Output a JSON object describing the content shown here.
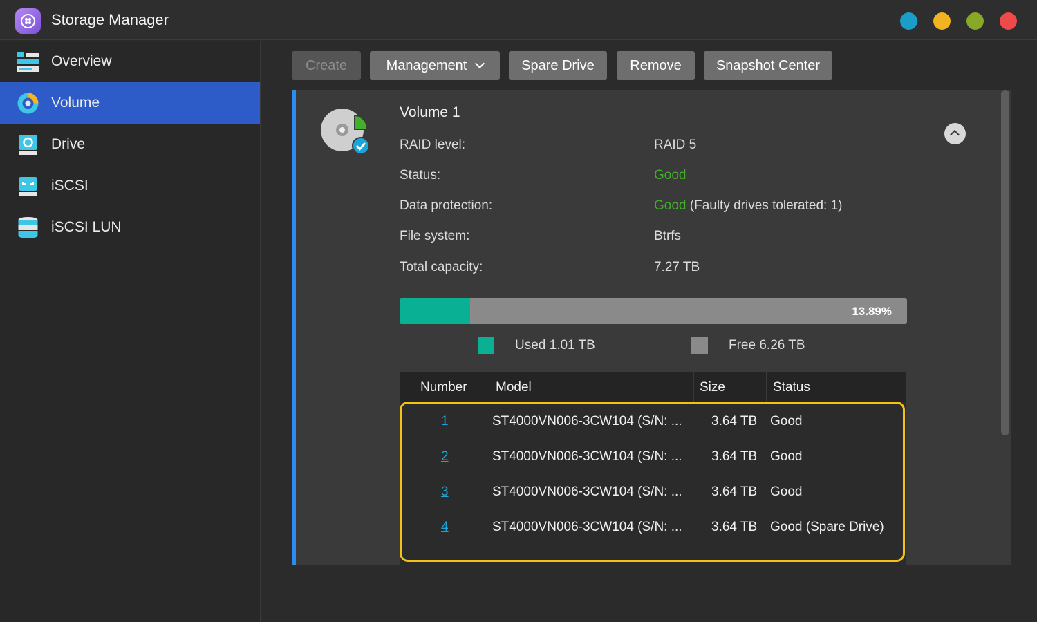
{
  "window": {
    "title": "Storage Manager",
    "controls": [
      {
        "name": "window-control-blue",
        "color": "#1a9ec9"
      },
      {
        "name": "window-control-yellow",
        "color": "#f3b320"
      },
      {
        "name": "window-control-green",
        "color": "#87a926"
      },
      {
        "name": "window-control-red",
        "color": "#ef4a4a"
      }
    ]
  },
  "sidebar": {
    "items": [
      {
        "label": "Overview",
        "icon": "overview-icon",
        "active": false
      },
      {
        "label": "Volume",
        "icon": "volume-icon",
        "active": true
      },
      {
        "label": "Drive",
        "icon": "drive-icon",
        "active": false
      },
      {
        "label": "iSCSI",
        "icon": "iscsi-icon",
        "active": false
      },
      {
        "label": "iSCSI LUN",
        "icon": "iscsi-lun-icon",
        "active": false
      }
    ]
  },
  "toolbar": {
    "create": "Create",
    "management": "Management",
    "spare_drive": "Spare Drive",
    "remove": "Remove",
    "snapshot_center": "Snapshot Center"
  },
  "volume": {
    "title": "Volume 1",
    "properties": {
      "raid_label": "RAID level:",
      "raid_value": "RAID 5",
      "status_label": "Status:",
      "status_value": "Good",
      "protection_label": "Data protection:",
      "protection_value": "Good",
      "protection_note": " (Faulty drives tolerated: 1)",
      "fs_label": "File system:",
      "fs_value": "Btrfs",
      "capacity_label": "Total capacity:",
      "capacity_value": "7.27 TB"
    },
    "usage": {
      "percent_text": "13.89%",
      "used_fraction": 0.1389,
      "used_label": "Used 1.01 TB",
      "free_label": "Free 6.26 TB",
      "used_color": "#0ab094",
      "free_color": "#8a8a8a"
    }
  },
  "drive_table": {
    "headers": {
      "number": "Number",
      "model": "Model",
      "size": "Size",
      "status": "Status"
    },
    "rows": [
      {
        "number": "1",
        "model": "ST4000VN006-3CW104 (S/N: ...",
        "size": "3.64 TB",
        "status": "Good"
      },
      {
        "number": "2",
        "model": "ST4000VN006-3CW104 (S/N: ...",
        "size": "3.64 TB",
        "status": "Good"
      },
      {
        "number": "3",
        "model": "ST4000VN006-3CW104 (S/N: ...",
        "size": "3.64 TB",
        "status": "Good"
      },
      {
        "number": "4",
        "model": "ST4000VN006-3CW104 (S/N: ...",
        "size": "3.64 TB",
        "status": "Good (Spare Drive)"
      }
    ]
  },
  "colors": {
    "accent": "#2d5bc7",
    "good": "#43b02a",
    "link": "#1aa6d8",
    "highlight": "#f2c21b"
  }
}
